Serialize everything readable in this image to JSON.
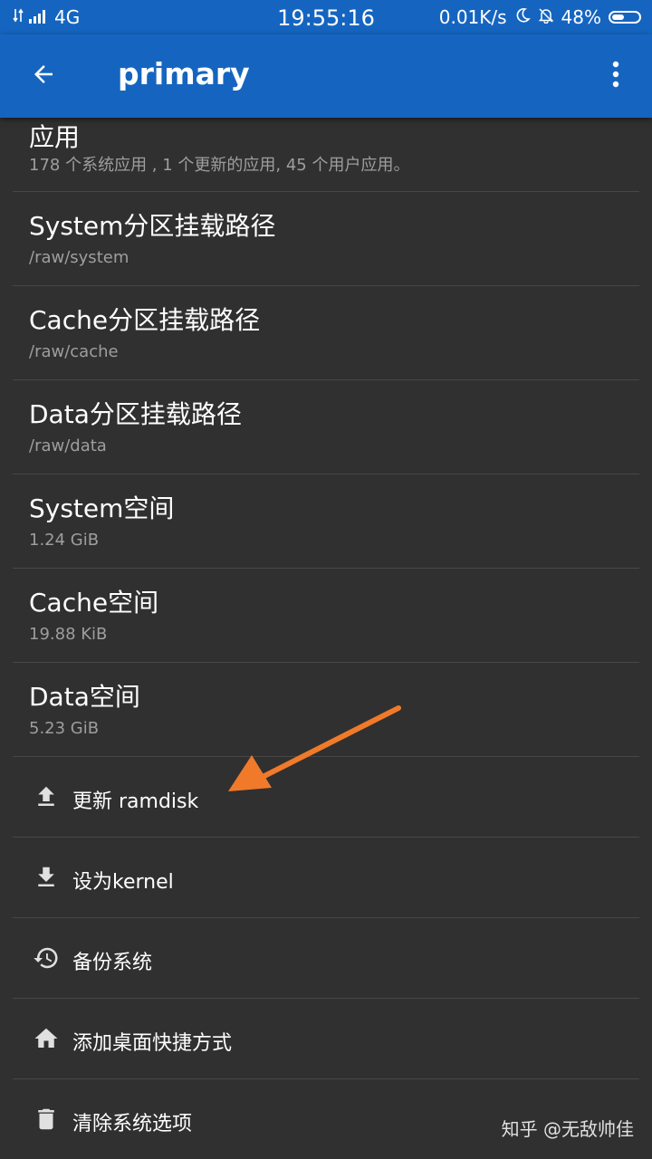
{
  "status_bar": {
    "network": "4G",
    "time": "19:55:16",
    "speed": "0.01K/s",
    "battery": "48%"
  },
  "app_bar": {
    "title": "primary"
  },
  "info_items": [
    {
      "title": "应用",
      "subtitle": "178 个系统应用 , 1 个更新的应用, 45 个用户应用。"
    },
    {
      "title": "System分区挂载路径",
      "subtitle": "/raw/system"
    },
    {
      "title": "Cache分区挂载路径",
      "subtitle": "/raw/cache"
    },
    {
      "title": "Data分区挂载路径",
      "subtitle": "/raw/data"
    },
    {
      "title": "System空间",
      "subtitle": "1.24 GiB"
    },
    {
      "title": "Cache空间",
      "subtitle": "19.88 KiB"
    },
    {
      "title": "Data空间",
      "subtitle": "5.23 GiB"
    }
  ],
  "actions": [
    {
      "label": "更新 ramdisk",
      "icon": "upload-icon"
    },
    {
      "label": "设为kernel",
      "icon": "download-icon"
    },
    {
      "label": "备份系统",
      "icon": "backup-restore-icon"
    },
    {
      "label": "添加桌面快捷方式",
      "icon": "home-icon"
    },
    {
      "label": "清除系统选项",
      "icon": "trash-icon"
    }
  ],
  "watermark": "知乎 @无敌帅佳",
  "colors": {
    "appbar": "#1565c0",
    "background": "#303030",
    "subtitle": "#9e9e9e",
    "annotation_arrow": "#f07a2a"
  }
}
